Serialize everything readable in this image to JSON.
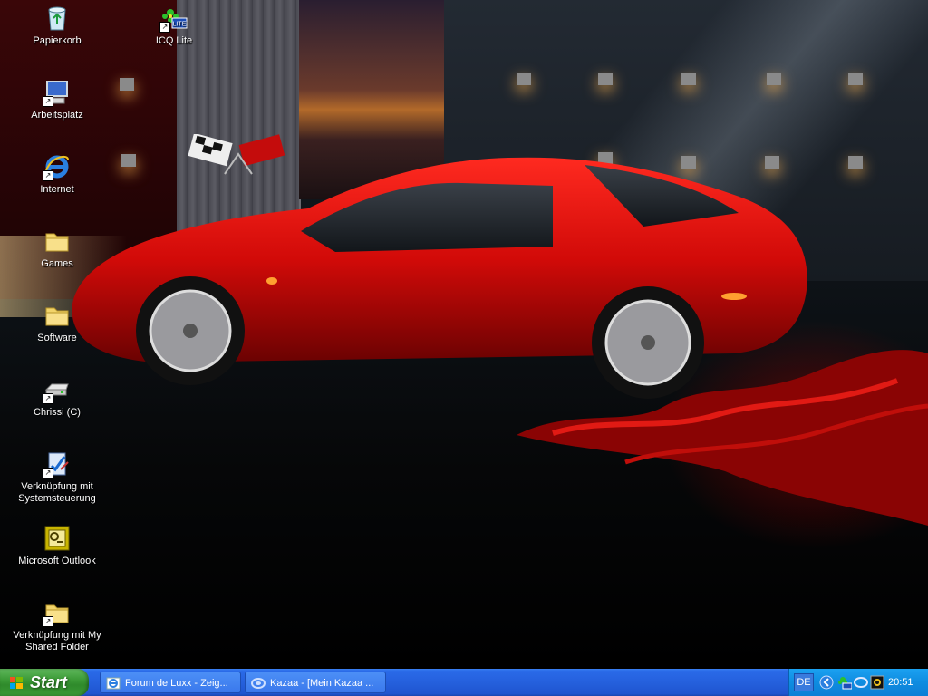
{
  "desktop": {
    "icons": [
      {
        "label": "Papierkorb",
        "icon": "recycle-bin-icon"
      },
      {
        "label": "ICQ Lite",
        "icon": "icq-icon"
      },
      {
        "label": "Arbeitsplatz",
        "icon": "my-computer-icon"
      },
      {
        "label": "Internet",
        "icon": "internet-explorer-icon"
      },
      {
        "label": "Games",
        "icon": "folder-icon"
      },
      {
        "label": "Software",
        "icon": "folder-icon"
      },
      {
        "label": "Chrissi (C)",
        "icon": "drive-icon"
      },
      {
        "label_line1": "Verknüpfung mit",
        "label_line2": "Systemsteuerung",
        "icon": "control-panel-icon"
      },
      {
        "label": "Microsoft Outlook",
        "icon": "outlook-icon"
      },
      {
        "label_line1": "Verknüpfung mit My",
        "label_line2": "Shared Folder",
        "icon": "folder-icon"
      }
    ],
    "shortcut_arrow": "↗"
  },
  "taskbar": {
    "start_label": "Start",
    "tasks": [
      {
        "label": "Forum de Luxx - Zeig...",
        "icon": "internet-explorer-icon"
      },
      {
        "label": "Kazaa - [Mein Kazaa ...",
        "icon": "kazaa-icon"
      }
    ],
    "language": "DE",
    "tray_icons": [
      "show-hidden-icons-chevron",
      "icq-tray-icon",
      "kazaa-tray-icon",
      "network-tray-icon"
    ],
    "clock": "20:51"
  },
  "colors": {
    "taskbar_blue": "#2560dd",
    "start_green": "#3c9a37",
    "tray_blue": "#0f8ce0"
  }
}
